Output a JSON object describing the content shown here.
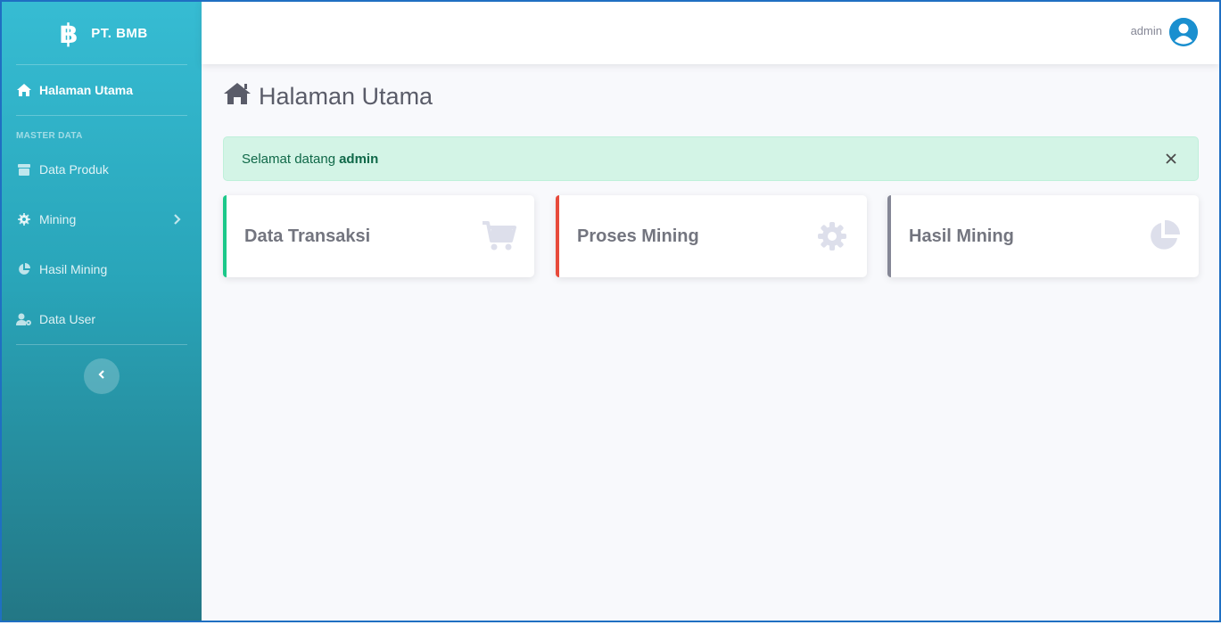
{
  "sidebar": {
    "brand": "PT. BMB",
    "items": [
      {
        "label": "Halaman Utama",
        "icon": "home-icon",
        "active": true
      },
      {
        "label": "Data Produk",
        "icon": "box-icon"
      },
      {
        "label": "Mining",
        "icon": "gear-icon",
        "has_submenu": true
      },
      {
        "label": "Hasil Mining",
        "icon": "pie-chart-icon"
      },
      {
        "label": "Data User",
        "icon": "user-gear-icon"
      }
    ],
    "heading": "MASTER DATA"
  },
  "topbar": {
    "username": "admin"
  },
  "page": {
    "title": "Halaman Utama"
  },
  "alert": {
    "text": "Selamat datang",
    "user": "admin"
  },
  "cards": [
    {
      "title": "Data Transaksi",
      "icon": "cart-icon",
      "accent": "#1cc88a"
    },
    {
      "title": "Proses Mining",
      "icon": "gear-icon",
      "accent": "#e74a3b"
    },
    {
      "title": "Hasil Mining",
      "icon": "pie-chart-icon",
      "accent": "#858796"
    }
  ],
  "colors": {
    "sidebar_top": "#36bcd3",
    "sidebar_bottom": "#237785",
    "avatar": "#1a8fcf"
  }
}
